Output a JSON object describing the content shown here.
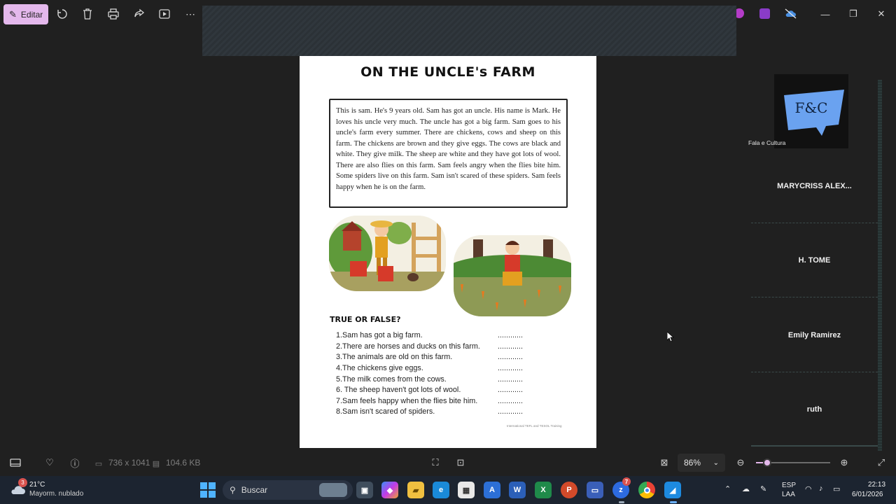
{
  "toolbar": {
    "edit_label": "Editar"
  },
  "worksheet": {
    "title": "ON THE UNCLE's FARM",
    "story": "This is sam. He's 9 years old. Sam has got an uncle. His name is Mark. He loves his uncle very much. The uncle has got a big farm. Sam goes to his uncle's farm every summer. There are chickens, cows and sheep on this farm. The chickens are brown and they give eggs. The cows are black and white. They give milk. The sheep are white and they have got lots of wool. There are also flies on this farm. Sam feels angry when the flies bite him. Some spiders live on this farm. Sam isn't scared of these spiders. Sam feels happy when he is on the farm.",
    "tf_title": "TRUE OR FALSE?",
    "questions": [
      "1.Sam has got a big farm.",
      "2.There are horses and ducks on this farm.",
      "3.The animals are old on this farm.",
      "4.The chickens give eggs.",
      "5.The milk comes from the cows.",
      "6. The sheep haven't got lots of wool.",
      "7.Sam feels happy when the flies bite him.",
      "8.Sam isn't scared of spiders."
    ],
    "answer_blank": "............",
    "footer": "International TEFL and TESOL Training"
  },
  "participants": {
    "host_logo_text": "F&C",
    "host_name": "Fala e Cultura",
    "names": [
      "MARYCRISS  ALEX...",
      "H. TOME",
      "Emily Ramirez",
      "ruth"
    ]
  },
  "statusbar": {
    "dimensions": "736 x 1041",
    "file_size": "104.6 KB",
    "zoom": "86%"
  },
  "taskbar": {
    "weather_temp": "21°C",
    "weather_desc": "Mayorm. nublado",
    "weather_badge": "3",
    "search_placeholder": "Buscar",
    "lang_top": "ESP",
    "lang_bottom": "LAA",
    "time": "22:13",
    "date": "6/01/2026",
    "zoom_badge": "7"
  }
}
